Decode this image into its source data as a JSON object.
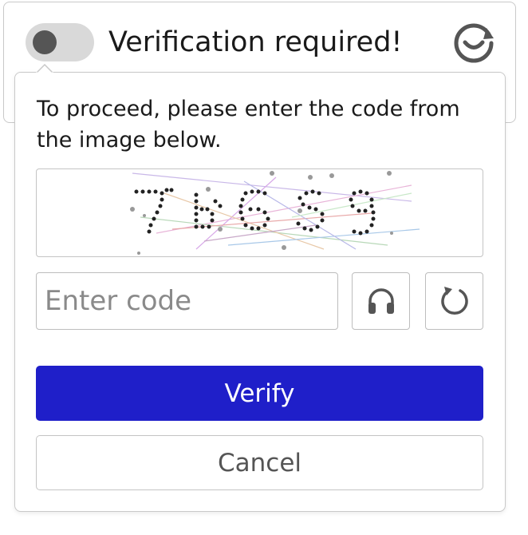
{
  "header": {
    "title": "Verification required!",
    "logo_icon": "captcha-refresh-logo-icon",
    "toggle_icon": "toggle-switch-icon"
  },
  "popup": {
    "instructions": "To proceed, please enter the code from the image below.",
    "captcha_image": "captcha-image",
    "input": {
      "value": "",
      "placeholder": "Enter code"
    },
    "audio_button_icon": "headphones-icon",
    "reload_button_icon": "reload-icon",
    "verify_label": "Verify",
    "cancel_label": "Cancel"
  },
  "colors": {
    "verify_bg": "#1f1fc9",
    "verify_text": "#ffffff",
    "border": "#c9c9c9",
    "toggle_track": "#d9d9d9",
    "toggle_knob": "#555555",
    "icon": "#555555"
  }
}
